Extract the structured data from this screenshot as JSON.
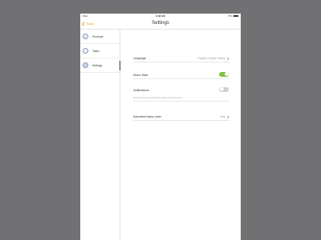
{
  "status_bar": {
    "carrier": "iPad",
    "time": "9:38 AM",
    "battery": "75%"
  },
  "nav": {
    "back_label": "Back",
    "title": "Settings"
  },
  "sidebar": {
    "items": [
      {
        "label": "Personal",
        "icon": "person-icon",
        "active": false
      },
      {
        "label": "Tasks",
        "icon": "tasks-check-icon",
        "active": false
      },
      {
        "label": "Settings",
        "icon": "settings-icon",
        "active": true
      }
    ]
  },
  "settings": {
    "language": {
      "label": "Language",
      "value": "English (United States)"
    },
    "share_data": {
      "label": "Share Data",
      "enabled": true
    },
    "notifications": {
      "label": "Notifications",
      "enabled": false,
      "helper": "We will send you an email when its time to another check"
    },
    "submitted_tasks_order": {
      "label": "Submitted tasks order",
      "value": "Date"
    }
  },
  "colors": {
    "accent": "#f5a623",
    "toggle_on": "#7cc242",
    "toggle_off": "#d0d0d0",
    "background": "#717174"
  }
}
